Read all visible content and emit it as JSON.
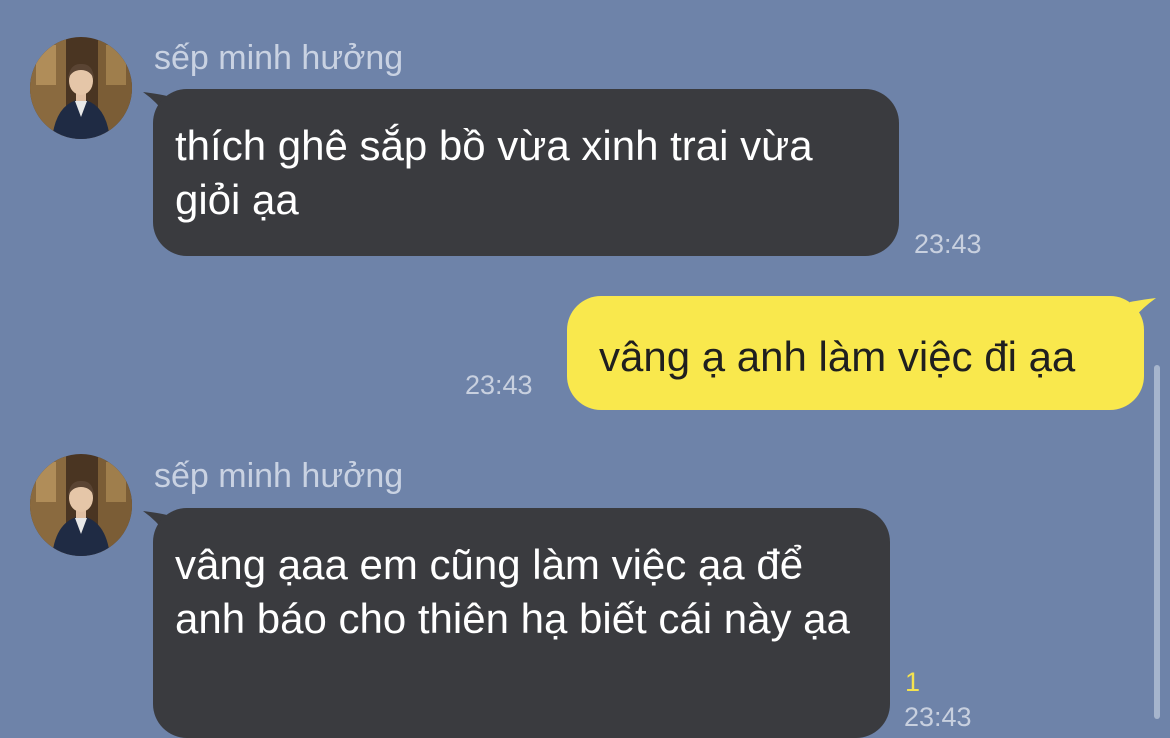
{
  "messages": [
    {
      "direction": "incoming",
      "sender": "sếp minh hưởng",
      "text": "thích ghê sắp bồ vừa xinh trai vừa giỏi ạa",
      "time": "23:43"
    },
    {
      "direction": "outgoing",
      "text": "vâng ạ anh làm việc đi ạa",
      "time": "23:43"
    },
    {
      "direction": "incoming",
      "sender": "sếp minh hưởng",
      "text": "vâng ạaa em cũng làm việc ạa để anh báo cho thiên hạ biết cái này ạa",
      "time": "23:43",
      "unread_count": "1"
    }
  ],
  "colors": {
    "background": "#6e83a9",
    "incoming_bubble": "#3a3b3f",
    "outgoing_bubble": "#f9e84d",
    "unread_count": "#f4e24f"
  },
  "icons": {
    "avatar": "profile-photo"
  }
}
